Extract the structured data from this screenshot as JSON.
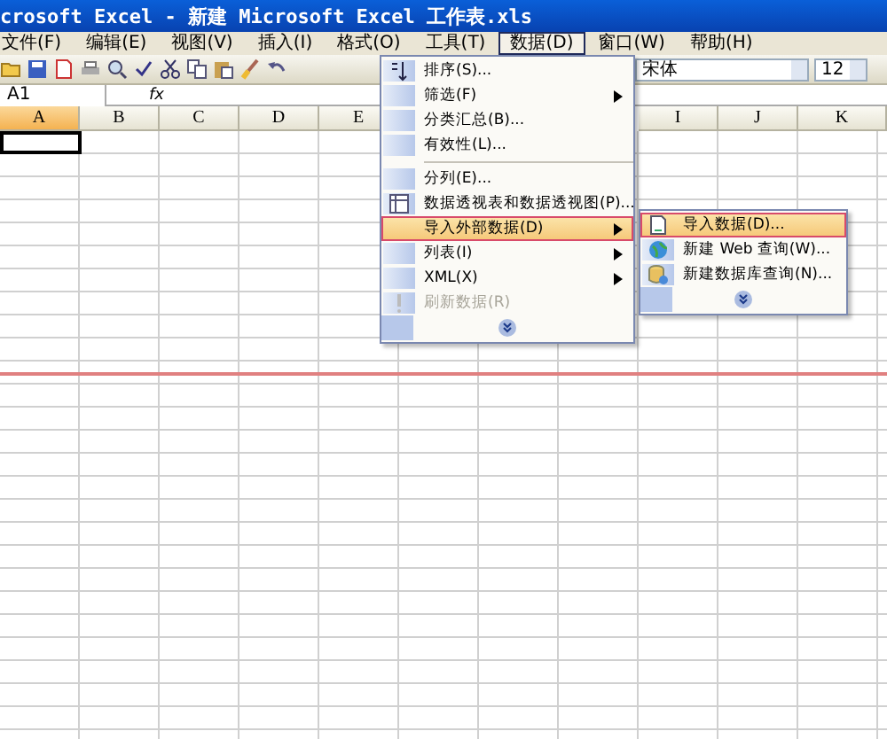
{
  "window": {
    "title": "crosoft Excel - 新建 Microsoft Excel 工作表.xls"
  },
  "menu_bar": [
    {
      "label": "文件(F)",
      "selected": false
    },
    {
      "label": "编辑(E)",
      "selected": false
    },
    {
      "label": "视图(V)",
      "selected": false
    },
    {
      "label": "插入(I)",
      "selected": false
    },
    {
      "label": "格式(O)",
      "selected": false
    },
    {
      "label": "工具(T)",
      "selected": false
    },
    {
      "label": "数据(D)",
      "selected": true
    },
    {
      "label": "窗口(W)",
      "selected": false
    },
    {
      "label": "帮助(H)",
      "selected": false
    }
  ],
  "toolbar": {
    "font": "宋体",
    "font_size": "12"
  },
  "formula_bar": {
    "name_box": "A1",
    "fx": "fx"
  },
  "columns": {
    "left": [
      {
        "label": "A",
        "selected": true
      },
      {
        "label": "B",
        "selected": false
      },
      {
        "label": "C",
        "selected": false
      },
      {
        "label": "D",
        "selected": false
      },
      {
        "label": "E",
        "selected": false
      }
    ],
    "right": [
      {
        "label": "I",
        "selected": false
      },
      {
        "label": "J",
        "selected": false
      },
      {
        "label": "K",
        "selected": false
      }
    ]
  },
  "data_menu": [
    {
      "kind": "item",
      "label": "排序(S)...",
      "submenu": false,
      "selected": false,
      "disabled": false
    },
    {
      "kind": "item",
      "label": "筛选(F)",
      "submenu": true,
      "selected": false,
      "disabled": false
    },
    {
      "kind": "item",
      "label": "分类汇总(B)...",
      "submenu": false,
      "selected": false,
      "disabled": false
    },
    {
      "kind": "item",
      "label": "有效性(L)...",
      "submenu": false,
      "selected": false,
      "disabled": false
    },
    {
      "kind": "separator"
    },
    {
      "kind": "item",
      "label": "分列(E)...",
      "submenu": false,
      "selected": false,
      "disabled": false
    },
    {
      "kind": "item",
      "label": "数据透视表和数据透视图(P)...",
      "submenu": false,
      "selected": false,
      "disabled": false
    },
    {
      "kind": "item",
      "label": "导入外部数据(D)",
      "submenu": true,
      "selected": true,
      "disabled": false
    },
    {
      "kind": "item",
      "label": "列表(I)",
      "submenu": true,
      "selected": false,
      "disabled": false
    },
    {
      "kind": "item",
      "label": "XML(X)",
      "submenu": true,
      "selected": false,
      "disabled": false
    },
    {
      "kind": "item",
      "label": "刷新数据(R)",
      "submenu": false,
      "selected": false,
      "disabled": true
    },
    {
      "kind": "expand"
    }
  ],
  "import_submenu": [
    {
      "kind": "item",
      "label": "导入数据(D)...",
      "selected": true
    },
    {
      "kind": "item",
      "label": "新建 Web 查询(W)...",
      "selected": false
    },
    {
      "kind": "item",
      "label": "新建数据库查询(N)...",
      "selected": false
    },
    {
      "kind": "expand"
    }
  ]
}
